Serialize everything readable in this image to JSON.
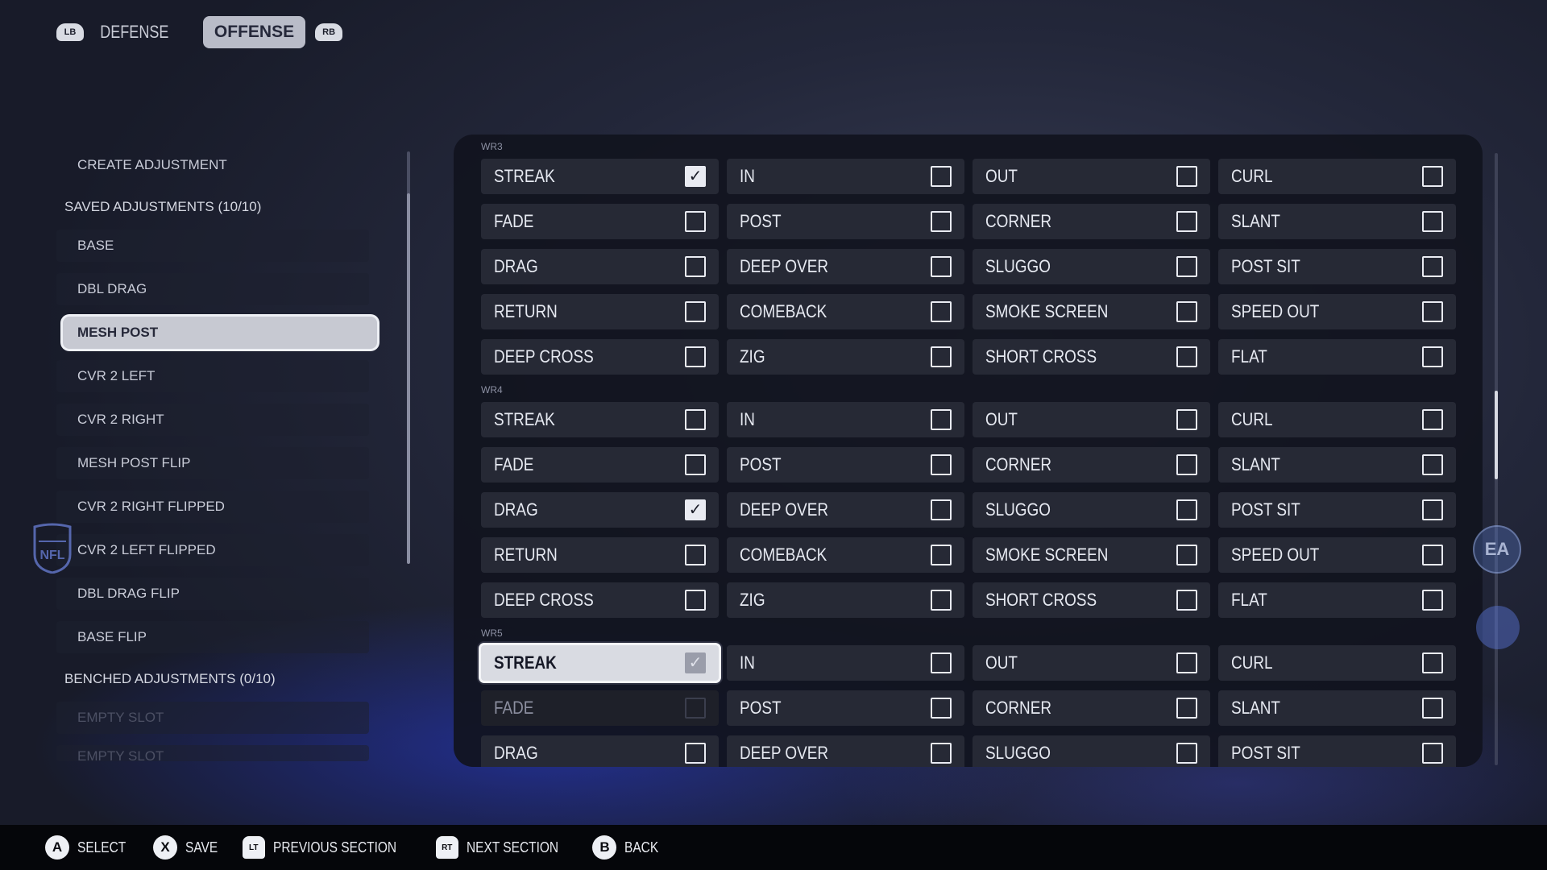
{
  "top": {
    "lb": "LB",
    "rb": "RB",
    "tabs": [
      "DEFENSE",
      "OFFENSE"
    ]
  },
  "sidebar": {
    "create": "CREATE ADJUSTMENT",
    "saved_header": "SAVED ADJUSTMENTS (10/10)",
    "items": [
      "BASE",
      "DBL DRAG",
      "MESH POST",
      "CVR 2 LEFT",
      "CVR 2 RIGHT",
      "MESH POST FLIP",
      "CVR 2 RIGHT FLIPPED",
      "CVR 2 LEFT FLIPPED",
      "DBL DRAG FLIP",
      "BASE FLIP"
    ],
    "selected_item": "MESH POST",
    "benched_header": "BENCHED ADJUSTMENTS (0/10)",
    "empty_slots": [
      "EMPTY SLOT",
      "EMPTY SLOT"
    ]
  },
  "routes": {
    "groups": [
      {
        "label": "WR3",
        "rows": [
          [
            {
              "l": "STREAK",
              "c": true
            },
            {
              "l": "IN",
              "c": false
            },
            {
              "l": "OUT",
              "c": false
            },
            {
              "l": "CURL",
              "c": false
            }
          ],
          [
            {
              "l": "FADE",
              "c": false
            },
            {
              "l": "POST",
              "c": false
            },
            {
              "l": "CORNER",
              "c": false
            },
            {
              "l": "SLANT",
              "c": false
            }
          ],
          [
            {
              "l": "DRAG",
              "c": false
            },
            {
              "l": "DEEP OVER",
              "c": false
            },
            {
              "l": "SLUGGO",
              "c": false
            },
            {
              "l": "POST SIT",
              "c": false
            }
          ],
          [
            {
              "l": "RETURN",
              "c": false
            },
            {
              "l": "COMEBACK",
              "c": false
            },
            {
              "l": "SMOKE SCREEN",
              "c": false
            },
            {
              "l": "SPEED OUT",
              "c": false
            }
          ],
          [
            {
              "l": "DEEP CROSS",
              "c": false
            },
            {
              "l": "ZIG",
              "c": false
            },
            {
              "l": "SHORT CROSS",
              "c": false
            },
            {
              "l": "FLAT",
              "c": false
            }
          ]
        ]
      },
      {
        "label": "WR4",
        "rows": [
          [
            {
              "l": "STREAK",
              "c": false
            },
            {
              "l": "IN",
              "c": false
            },
            {
              "l": "OUT",
              "c": false
            },
            {
              "l": "CURL",
              "c": false
            }
          ],
          [
            {
              "l": "FADE",
              "c": false
            },
            {
              "l": "POST",
              "c": false
            },
            {
              "l": "CORNER",
              "c": false
            },
            {
              "l": "SLANT",
              "c": false
            }
          ],
          [
            {
              "l": "DRAG",
              "c": true
            },
            {
              "l": "DEEP OVER",
              "c": false
            },
            {
              "l": "SLUGGO",
              "c": false
            },
            {
              "l": "POST SIT",
              "c": false
            }
          ],
          [
            {
              "l": "RETURN",
              "c": false
            },
            {
              "l": "COMEBACK",
              "c": false
            },
            {
              "l": "SMOKE SCREEN",
              "c": false
            },
            {
              "l": "SPEED OUT",
              "c": false
            }
          ],
          [
            {
              "l": "DEEP CROSS",
              "c": false
            },
            {
              "l": "ZIG",
              "c": false
            },
            {
              "l": "SHORT CROSS",
              "c": false
            },
            {
              "l": "FLAT",
              "c": false
            }
          ]
        ]
      },
      {
        "label": "WR5",
        "rows": [
          [
            {
              "l": "STREAK",
              "c": true,
              "hl": true
            },
            {
              "l": "IN",
              "c": false
            },
            {
              "l": "OUT",
              "c": false
            },
            {
              "l": "CURL",
              "c": false
            }
          ],
          [
            {
              "l": "FADE",
              "c": false,
              "dim": true
            },
            {
              "l": "POST",
              "c": false
            },
            {
              "l": "CORNER",
              "c": false
            },
            {
              "l": "SLANT",
              "c": false
            }
          ],
          [
            {
              "l": "DRAG",
              "c": false
            },
            {
              "l": "DEEP OVER",
              "c": false
            },
            {
              "l": "SLUGGO",
              "c": false
            },
            {
              "l": "POST SIT",
              "c": false
            }
          ]
        ]
      }
    ]
  },
  "bottom": {
    "hints": [
      {
        "icon": "A",
        "kind": "round",
        "label": "SELECT",
        "name": "select"
      },
      {
        "icon": "X",
        "kind": "round",
        "label": "SAVE",
        "name": "save"
      },
      {
        "icon": "LT",
        "kind": "trig",
        "label": "PREVIOUS SECTION",
        "name": "previous-section"
      },
      {
        "icon": "RT",
        "kind": "trig",
        "label": "NEXT SECTION",
        "name": "next-section"
      },
      {
        "icon": "B",
        "kind": "round",
        "label": "BACK",
        "name": "back"
      }
    ]
  }
}
